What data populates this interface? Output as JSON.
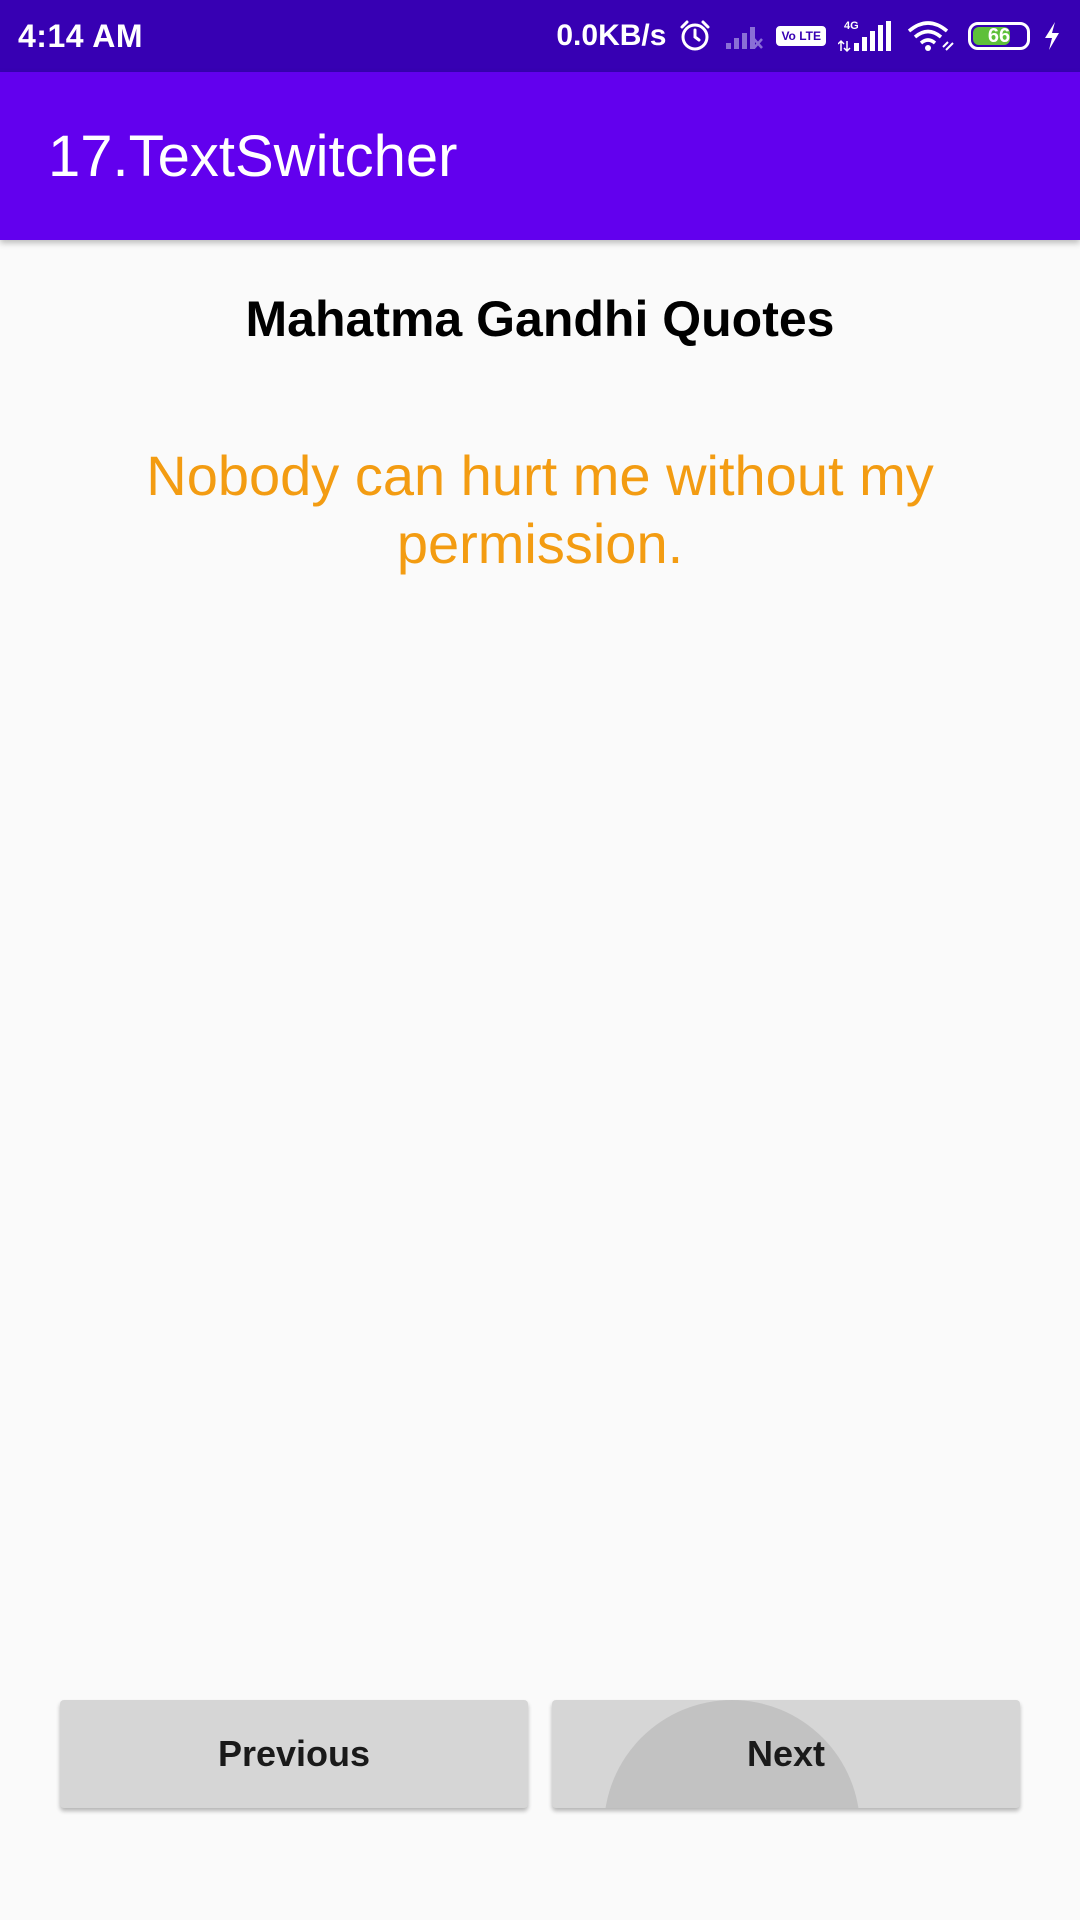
{
  "status_bar": {
    "time": "4:14 AM",
    "net_speed": "0.0KB/s",
    "volte_label": "Vo LTE",
    "network_type": "4G",
    "battery_level": "66",
    "icons": [
      "alarm-icon",
      "signal-off-icon",
      "volte-icon",
      "signal-4g-icon",
      "wifi-icon",
      "battery-icon",
      "charging-icon"
    ]
  },
  "app_bar": {
    "title": "17.TextSwitcher",
    "color": "#6200ee"
  },
  "main": {
    "heading": "Mahatma Gandhi Quotes",
    "quote": "Nobody can hurt me without my permission.",
    "quote_color": "#f39c12"
  },
  "buttons": {
    "previous_label": "Previous",
    "next_label": "Next"
  }
}
